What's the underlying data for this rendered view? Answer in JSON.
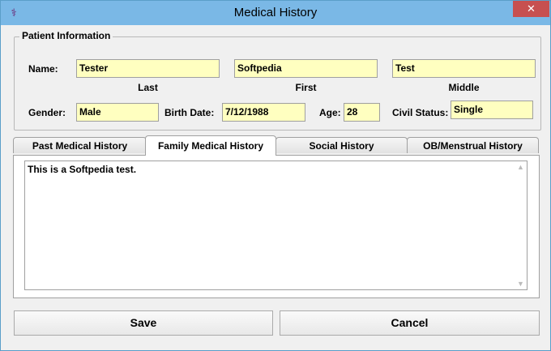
{
  "window": {
    "title": "Medical History",
    "close": "✕"
  },
  "patient": {
    "group_label": "Patient Information",
    "name_label": "Name:",
    "last": "Tester",
    "first": "Softpedia",
    "middle": "Test",
    "last_label": "Last",
    "first_label": "First",
    "middle_label": "Middle",
    "gender_label": "Gender:",
    "gender": "Male",
    "birth_label": "Birth Date:",
    "birth_date": "7/12/1988",
    "age_label": "Age:",
    "age": "28",
    "civil_label": "Civil Status:",
    "civil_status": "Single"
  },
  "tabs": [
    {
      "label": "Past Medical History"
    },
    {
      "label": "Family Medical History"
    },
    {
      "label": "Social History"
    },
    {
      "label": "OB/Menstrual History"
    }
  ],
  "history_text": "This is a Softpedia test.",
  "buttons": {
    "save": "Save",
    "cancel": "Cancel"
  },
  "colors": {
    "field_bg": "#ffffc0",
    "titlebar": "#7ab8e6",
    "close": "#c75050"
  }
}
